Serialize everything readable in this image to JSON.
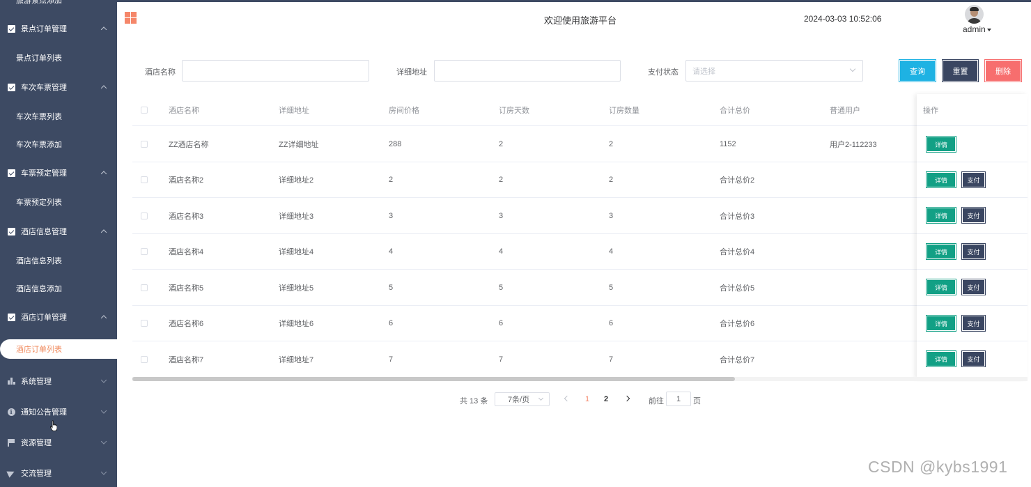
{
  "sidebar": {
    "top_cut_item": "旅游景点添加",
    "groups": [
      {
        "label": "景点订单管理",
        "icon": "check-square-icon"
      },
      {
        "label": "车次车票管理",
        "icon": "check-square-icon"
      },
      {
        "label": "车票预定管理",
        "icon": "check-square-icon"
      },
      {
        "label": "酒店信息管理",
        "icon": "check-square-icon"
      },
      {
        "label": "酒店订单管理",
        "icon": "check-square-icon"
      },
      {
        "label": "系统管理",
        "icon": "bar-chart-icon"
      },
      {
        "label": "通知公告管理",
        "icon": "info-icon"
      },
      {
        "label": "资源管理",
        "icon": "flag-icon"
      },
      {
        "label": "交流管理",
        "icon": "send-icon"
      }
    ],
    "items": [
      {
        "label": "景点订单列表"
      },
      {
        "label": "车次车票列表"
      },
      {
        "label": "车次车票添加"
      },
      {
        "label": "车票预定列表"
      },
      {
        "label": "酒店信息列表"
      },
      {
        "label": "酒店信息添加"
      },
      {
        "label": "酒店订单列表",
        "active": true
      }
    ],
    "colors": {
      "background": "#3d4a63",
      "active_text": "#f08a5d"
    }
  },
  "header": {
    "menu_icon": "grid-icon",
    "welcome": "欢迎使用旅游平台",
    "datetime": "2024-03-03 10:52:06",
    "username": "admin"
  },
  "search": {
    "hotel_name_label": "酒店名称",
    "hotel_name_value": "",
    "address_label": "详细地址",
    "address_value": "",
    "pay_status_label": "支付状态",
    "pay_status_placeholder": "请选择",
    "query_button": "查询",
    "reset_button": "重置",
    "delete_button": "删除"
  },
  "table": {
    "columns": [
      "酒店名称",
      "详细地址",
      "房间价格",
      "订房天数",
      "订房数量",
      "合计总价",
      "普通用户",
      "操作"
    ],
    "detail_label": "详情",
    "pay_label": "支付",
    "rows": [
      {
        "name": "ZZ酒店名称",
        "address": "ZZ详细地址",
        "price": "288",
        "days": "2",
        "count": "2",
        "total": "1152",
        "user": "用户2-112233",
        "can_pay": false
      },
      {
        "name": "酒店名称2",
        "address": "详细地址2",
        "price": "2",
        "days": "2",
        "count": "2",
        "total": "合计总价2",
        "user": "",
        "can_pay": true
      },
      {
        "name": "酒店名称3",
        "address": "详细地址3",
        "price": "3",
        "days": "3",
        "count": "3",
        "total": "合计总价3",
        "user": "",
        "can_pay": true
      },
      {
        "name": "酒店名称4",
        "address": "详细地址4",
        "price": "4",
        "days": "4",
        "count": "4",
        "total": "合计总价4",
        "user": "",
        "can_pay": true
      },
      {
        "name": "酒店名称5",
        "address": "详细地址5",
        "price": "5",
        "days": "5",
        "count": "5",
        "total": "合计总价5",
        "user": "",
        "can_pay": true
      },
      {
        "name": "酒店名称6",
        "address": "详细地址6",
        "price": "6",
        "days": "6",
        "count": "6",
        "total": "合计总价6",
        "user": "",
        "can_pay": true
      },
      {
        "name": "酒店名称7",
        "address": "详细地址7",
        "price": "7",
        "days": "7",
        "count": "7",
        "total": "合计总价7",
        "user": "",
        "can_pay": true
      }
    ]
  },
  "pagination": {
    "total_text": "共 13 条",
    "page_size": "7条/页",
    "pages": [
      "1",
      "2"
    ],
    "current_page": "1",
    "goto_label": "前往",
    "goto_value": "1",
    "page_suffix": "页"
  },
  "watermark": "CSDN @kybs1991",
  "colors": {
    "detail": "#12a085",
    "pay": "#3a4661",
    "query": "#1eb2e3",
    "reset": "#3a4661",
    "delete": "#f76e6e",
    "accent": "#f5876a"
  }
}
